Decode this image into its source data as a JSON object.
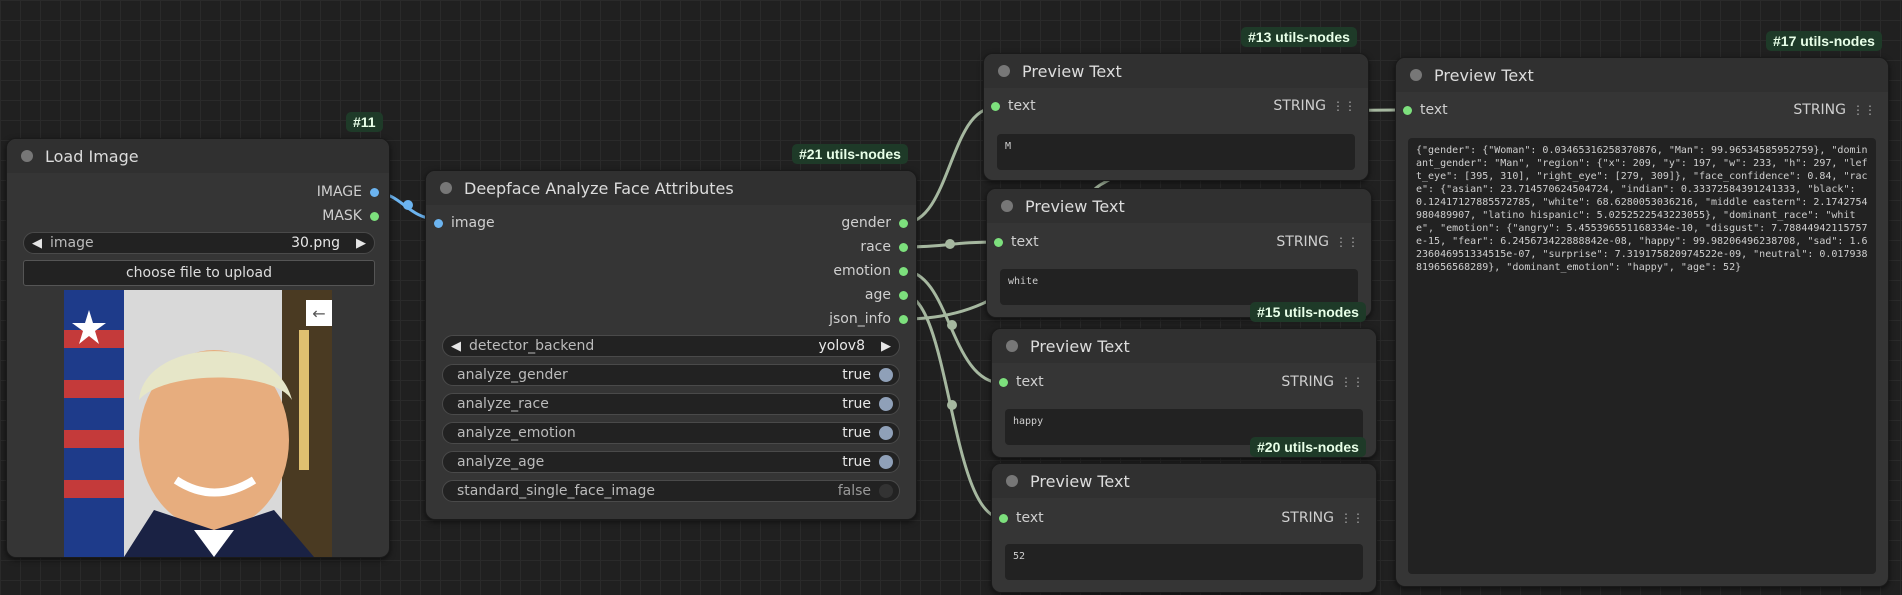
{
  "load_image": {
    "badge": "#11",
    "title": "Load Image",
    "outputs": [
      "IMAGE",
      "MASK"
    ],
    "image_widget": {
      "name": "image",
      "value": "30.png"
    },
    "upload_button": "choose file to upload"
  },
  "deepface": {
    "badge": "#21 utils-nodes",
    "title": "Deepface Analyze Face Attributes",
    "input": "image",
    "outputs": [
      "gender",
      "race",
      "emotion",
      "age",
      "json_info"
    ],
    "detector": {
      "name": "detector_backend",
      "value": "yolov8"
    },
    "toggles": [
      {
        "name": "analyze_gender",
        "value": "true",
        "on": true
      },
      {
        "name": "analyze_race",
        "value": "true",
        "on": true
      },
      {
        "name": "analyze_emotion",
        "value": "true",
        "on": true
      },
      {
        "name": "analyze_age",
        "value": "true",
        "on": true
      },
      {
        "name": "standard_single_face_image",
        "value": "false",
        "on": false
      }
    ]
  },
  "preview_title": "Preview Text",
  "text_label": "text",
  "string_label": "STRING",
  "previews": [
    {
      "badge": "#13 utils-nodes",
      "value": "M"
    },
    {
      "badge": "",
      "value": "white"
    },
    {
      "badge": "#15 utils-nodes",
      "value": "happy"
    },
    {
      "badge": "#20 utils-nodes",
      "value": "52"
    }
  ],
  "json_preview": {
    "badge": "#17 utils-nodes",
    "value": "{\"gender\": {\"Woman\": 0.03465316258370876, \"Man\": 99.96534585952759}, \"dominant_gender\": \"Man\", \"region\": {\"x\": 209, \"y\": 197, \"w\": 233, \"h\": 297, \"left_eye\": [395, 310], \"right_eye\": [279, 309]}, \"face_confidence\": 0.84, \"race\": {\"asian\": 23.714570624504724, \"indian\": 0.33372584391241333, \"black\": 0.12417127885572785, \"white\": 68.6280053036216, \"middle eastern\": 2.1742754980489907, \"latino hispanic\": 5.0252522543223055}, \"dominant_race\": \"white\", \"emotion\": {\"angry\": 5.455396551168334e-10, \"disgust\": 7.78844942115757e-15, \"fear\": 6.245673422888842e-08, \"happy\": 99.98206496238708, \"sad\": 1.6236046951334515e-07, \"surprise\": 7.319175820974522e-09, \"neutral\": 0.017938819656568289}, \"dominant_emotion\": \"happy\", \"age\": 52}"
  },
  "colors": {
    "image_slot": "#6cb4f0",
    "mask_slot": "#7de07d",
    "string_slot": "#7de07d",
    "link": "#a6b8a0",
    "image_link": "#6cb4f0"
  },
  "icons": [
    "back-arrow-icon",
    "grid-icon"
  ]
}
